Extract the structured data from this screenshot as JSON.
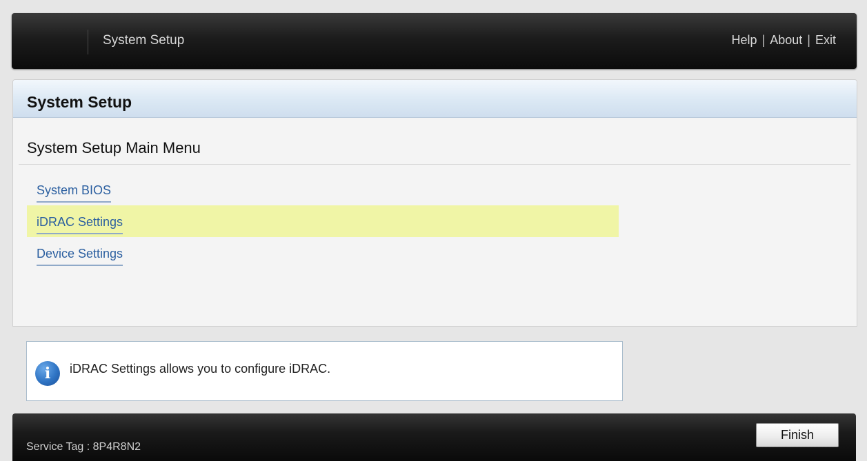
{
  "header": {
    "app_title": "System Setup",
    "links": {
      "help": "Help",
      "about": "About",
      "exit": "Exit",
      "separator": "|"
    }
  },
  "panel": {
    "title": "System Setup",
    "menu_heading": "System Setup Main Menu",
    "menu_items": [
      {
        "label": "System BIOS",
        "selected": false
      },
      {
        "label": "iDRAC Settings",
        "selected": true
      },
      {
        "label": "Device Settings",
        "selected": false
      }
    ]
  },
  "info": {
    "icon": "info-icon",
    "message": "iDRAC Settings allows you to configure iDRAC."
  },
  "footer": {
    "service_tag": "Service Tag : 8P4R8N2",
    "finish_label": "Finish"
  },
  "colors": {
    "link": "#2b5fa0",
    "selected_bg": "#f0f5a6",
    "header_bar": "#1c1c1c"
  }
}
